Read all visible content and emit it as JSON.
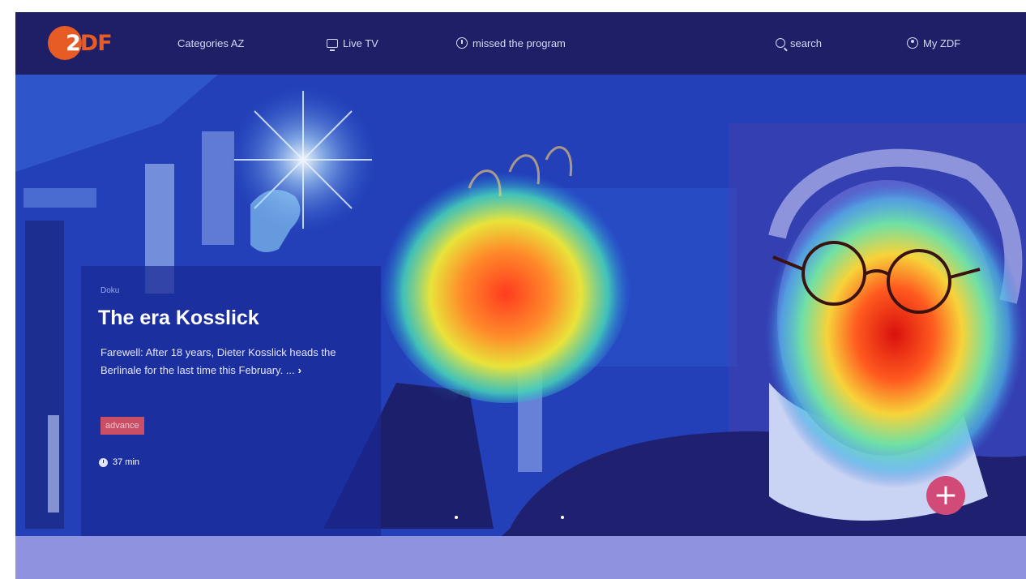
{
  "brand": {
    "logo_text_2": "2",
    "logo_text_df": "DF"
  },
  "nav": {
    "categories_label": "Categories AZ",
    "live_tv_label": "Live TV",
    "missed_label": "missed the program",
    "search_label": "search",
    "my_zdf_label": "My ZDF"
  },
  "hero": {
    "kicker": "Doku",
    "title": "The era Kosslick",
    "description": "Farewell: After 18 years, Dieter Kosslick heads the Berlinale for the last time this February. ...",
    "more_arrow": "›",
    "badge": "advance",
    "duration": "37 min",
    "add_symbol": "+"
  },
  "colors": {
    "nav_background": "#1e1f67",
    "logo_orange": "#e75b24",
    "badge": "#c84f66",
    "add_button": "#d14a78",
    "bottom_strip": "#8e92df"
  }
}
